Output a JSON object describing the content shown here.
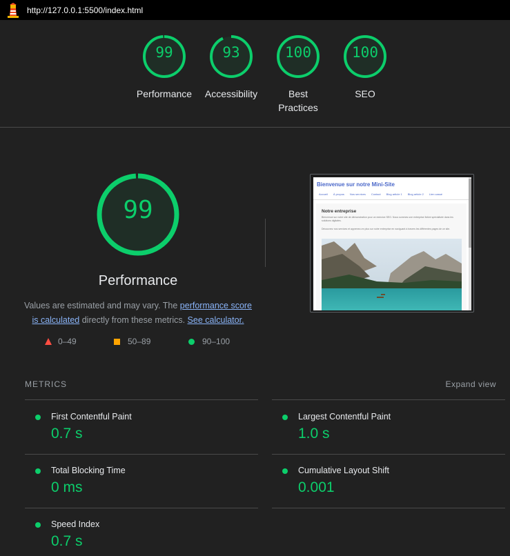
{
  "browser": {
    "url": "http://127.0.0.1:5500/index.html",
    "icon": "lighthouse-icon"
  },
  "gauges": [
    {
      "score": "99",
      "label": "Performance"
    },
    {
      "score": "93",
      "label": "Accessibility"
    },
    {
      "score": "100",
      "label": "Best Practices"
    },
    {
      "score": "100",
      "label": "SEO"
    }
  ],
  "performance": {
    "score": "99",
    "title": "Performance",
    "desc_pre": "Values are estimated and may vary. The ",
    "desc_link1": "performance score is calculated",
    "desc_mid": " directly from these metrics. ",
    "desc_link2": "See calculator."
  },
  "legend": {
    "fail": "0–49",
    "average": "50–89",
    "pass": "90–100"
  },
  "colors": {
    "pass": "#0cce6b",
    "average": "#ffa400",
    "fail": "#ff4e42",
    "link": "#8ab4f8"
  },
  "thumbnail": {
    "title": "Bienvenue sur notre Mini-Site",
    "nav": [
      "Accueil",
      "À propos",
      "Nos services",
      "Contact",
      "Blog article 1",
      "Blog article 2",
      "Lien cassé"
    ],
    "heading": "Notre entreprise",
    "para1": "Bienvenue sur notre site de démonstration pour un exercice SEO. Nous sommes une entreprise fictive spécialisée dans les solutions digitales.",
    "para2": "Découvrez nos services et apprenez-en plus sur notre entreprise en naviguant à travers les différentes pages de ce site."
  },
  "metrics": {
    "heading": "METRICS",
    "expand": "Expand view",
    "items": [
      {
        "name": "First Contentful Paint",
        "value": "0.7 s"
      },
      {
        "name": "Largest Contentful Paint",
        "value": "1.0 s"
      },
      {
        "name": "Total Blocking Time",
        "value": "0 ms"
      },
      {
        "name": "Cumulative Layout Shift",
        "value": "0.001"
      },
      {
        "name": "Speed Index",
        "value": "0.7 s"
      }
    ]
  }
}
